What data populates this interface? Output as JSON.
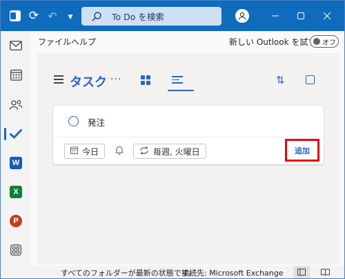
{
  "titlebar": {
    "search_placeholder": "To Do を検索",
    "icons": [
      "outlook-icon",
      "sync-icon",
      "undo-icon",
      "quick-access-dropdown-icon",
      "search-icon",
      "avatar-icon",
      "minimize-icon",
      "maximize-icon",
      "close-icon"
    ]
  },
  "menubar": {
    "file_label": "ファイル",
    "help_label": "ヘルプ",
    "new_outlook_label": "新しい Outlook を試す",
    "toggle_label": "オフ"
  },
  "rail": {
    "items": [
      {
        "icon": "mail-icon"
      },
      {
        "icon": "calendar-icon"
      },
      {
        "icon": "people-icon"
      },
      {
        "icon": "todo-check-icon",
        "active": true
      },
      {
        "icon": "word-icon",
        "letter": "W",
        "color": "#185abd"
      },
      {
        "icon": "excel-icon",
        "letter": "X",
        "color": "#107c41"
      },
      {
        "icon": "powerpoint-icon",
        "letter": "P",
        "color": "#c43e1c"
      },
      {
        "icon": "apps-icon"
      }
    ]
  },
  "main": {
    "title": "タスク",
    "more_label": "···"
  },
  "task_card": {
    "task_text": "発注",
    "due_chip": "今日",
    "repeat_chip": "毎週, 火曜日",
    "add_label": "追加"
  },
  "statusbar": {
    "sync_status": "すべてのフォルダーが最新の状態です。",
    "connection": "接続先: Microsoft Exchange"
  },
  "colors": {
    "titlebar": "#0f6cbd",
    "accent": "#2564cf",
    "highlight_box": "#e60012"
  }
}
